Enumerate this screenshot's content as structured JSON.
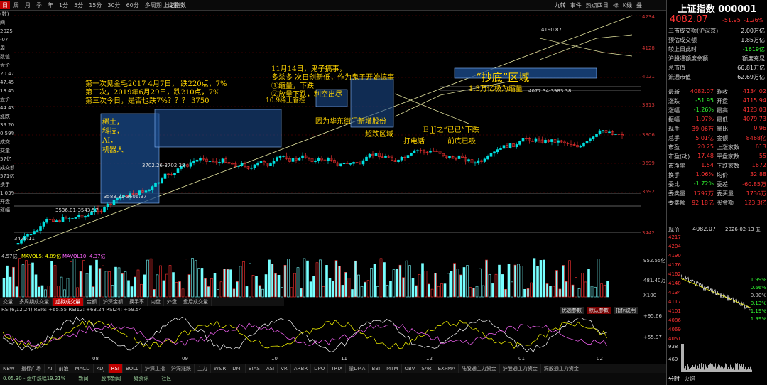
{
  "toolbar": {
    "periods": [
      "日",
      "周",
      "月",
      "季",
      "年",
      "1分",
      "5分",
      "15分",
      "30分",
      "60分",
      "多周期",
      "设置"
    ],
    "active_period": "日",
    "right_items": [
      "九转",
      "事件",
      "热点四日",
      "标",
      "K线",
      "叠"
    ],
    "index_label": "上证指数"
  },
  "left_labels": [
    "(数)",
    "间",
    "2025",
    "-07",
    "周一",
    "数值",
    "盘价",
    "20.47",
    "47.45",
    "13.45",
    "盘价",
    "44.43",
    "涨跌",
    "39.20",
    "0.59%",
    "成交",
    "交量",
    "57亿",
    "成交额",
    "571亿",
    "换手",
    "1.03%",
    "开盘",
    "涨幅"
  ],
  "price_axis": [
    "4234",
    "4128",
    "4021",
    "3913",
    "3806",
    "3699",
    "3592",
    "3442"
  ],
  "annotations": {
    "line1": "第一次见金毛2017   4月7日，   跌220点，7%",
    "line2": "第二次，2019年6月29日，跌210点，7%",
    "line3": "第三次今日，是否也跌7%？？？   3750",
    "rare_earth": "稀土，\n科技，\nAI，\n机器人",
    "nov14": "11月14日，鬼子搞事，",
    "duo_sha": "多杀多   次日创新低，作为鬼子开始搞事",
    "shrink": "①缩量，下跌",
    "drop": "②放量下跌，利空出尽",
    "ten9": "10.9稀土管控",
    "bottom_zone": "“抄底”区域",
    "huawei": "因为华东街门新增股份",
    "super_drop": "超跌区域",
    "call": "打电话",
    "jj": "E JJ之“已已”下跌",
    "front_low": "前底已吸",
    "vol_note": "1.3万亿极为缩量",
    "box1": "3583.31-3606.97",
    "box2": "3536.01-3543.57",
    "box3": "3702.26-3702.38",
    "box4": "4077.34-3983.38",
    "peak": "4190.87",
    "low_left": "3420.11"
  },
  "volume": {
    "label_left": "4.57亿",
    "mavol5": "MAVOL5: 4.89亿",
    "mavol10": "MAVOL10: 4.37亿",
    "axis_top": "952.55亿",
    "axis_mid": "481.40万",
    "axis_low": "X100",
    "tabs": [
      "交量",
      "多周期成交量",
      "虚拟成交量",
      "金额",
      "沪深金额",
      "换手率",
      "内盘",
      "外盘",
      "盘后成交量"
    ],
    "active_tab": "虚拟成交量"
  },
  "rsi": {
    "legend": "RSI(6,12,24) RSI6: +65.55  RSI12: +63.24  RSI24: +59.54",
    "axis_top": "+95.66",
    "axis_bottom": "+55.97",
    "buttons": [
      "优选参数",
      "默认参数",
      "指标说明"
    ],
    "months": [
      "08",
      "09",
      "10",
      "11",
      "12",
      "01",
      "02"
    ]
  },
  "indicator_tabs": [
    "NBW",
    "指标广场",
    "AI",
    "前浪",
    "MACD",
    "KDJ",
    "RSI",
    "BOLL",
    "沪深主指",
    "沪深涨跌",
    "主力",
    "W&R",
    "DMI",
    "BIAS",
    "ASI",
    "VR",
    "ARBR",
    "DPO",
    "TRIX",
    "量DMA",
    "BBI",
    "MTM",
    "OBV",
    "SAR",
    "EXPMA",
    "陆股通主力资金",
    "沪股通主力资金",
    "深股通主力资金"
  ],
  "active_indicator": "RSI",
  "statusbar": [
    "0.05.30 - 盘中涨幅19.21%",
    "新闻",
    "股市新闻",
    "疑资讯",
    "社区"
  ],
  "quote": {
    "name": "上证指数 000001",
    "price": "4082.07",
    "change": "-51.95",
    "change_pct": "-1.26%",
    "rows": [
      {
        "k": "三市成交额(沪深京)",
        "v": "2.00万亿"
      },
      {
        "k": "预估成交额",
        "v": "1.85万亿"
      },
      {
        "k": "较上日此时",
        "v": "-1619亿"
      },
      {
        "k": "沪股通额度余额",
        "v": "额度充足"
      },
      {
        "k": "总市值",
        "v": "66.81万亿"
      },
      {
        "k": "流通市值",
        "v": "62.69万亿"
      }
    ],
    "grid": [
      [
        "最新",
        "4082.07",
        "昨收",
        "4134.02"
      ],
      [
        "涨跌",
        "-51.95",
        "开盘",
        "4115.94"
      ],
      [
        "涨幅",
        "-1.26%",
        "最高",
        "4123.03"
      ],
      [
        "振幅",
        "1.07%",
        "最低",
        "4079.73"
      ],
      [
        "现手",
        "39.06万",
        "量比",
        "0.96"
      ],
      [
        "总手",
        "5.01亿",
        "金额",
        "8468亿"
      ],
      [
        "市盈",
        "20.25",
        "上涨家数",
        "613"
      ],
      [
        "市盈(动)",
        "17.48",
        "平盘家数",
        "55"
      ],
      [
        "市净率",
        "1.54",
        "下跌家数",
        "1672"
      ],
      [
        "换手",
        "1.06%",
        "均价",
        "32.88"
      ],
      [
        "委比",
        "-1.72%",
        "委差",
        "-60.85万"
      ],
      [
        "委卖量",
        "1797万",
        "委买量",
        "1736万"
      ],
      [
        "委卖额",
        "92.18亿",
        "买金额",
        "123.3亿"
      ]
    ],
    "mini_label": "现价",
    "mini_price": "4082.07",
    "mini_date": "2026-02-13 五",
    "mini_axis": [
      "4217",
      "4204",
      "4190",
      "4176",
      "4162",
      "4148",
      "4134",
      "4117",
      "4101",
      "4086",
      "4069",
      "4051"
    ],
    "mini_pct": [
      "1.99%",
      "0.66%",
      "0.00%",
      "0.13%",
      "1.19%",
      "1.99%"
    ],
    "mini_vol": [
      "938",
      "469"
    ],
    "mini_tabs": [
      "分时",
      "火焰"
    ]
  }
}
